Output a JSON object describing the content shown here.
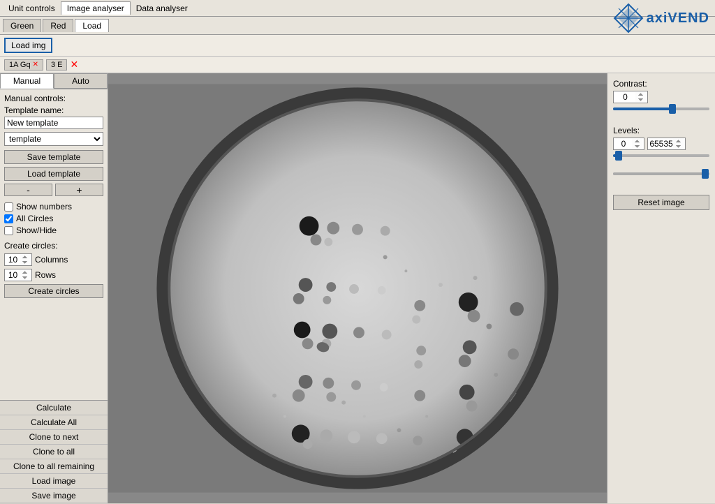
{
  "menubar": {
    "items": [
      "Unit controls",
      "Image analyser",
      "Data analyser"
    ],
    "active": "Image analyser"
  },
  "tabs": {
    "items": [
      "Green",
      "Red",
      "Load"
    ],
    "active": "Load"
  },
  "loadimg": {
    "button_label": "Load img"
  },
  "session": {
    "tab1": "1A Gq",
    "tab2": "3 E"
  },
  "panel": {
    "manual_tab": "Manual",
    "auto_tab": "Auto",
    "controls_label": "Manual controls:",
    "template_name_label": "Template name:",
    "template_name_value": "New template",
    "save_template": "Save template",
    "load_template": "Load template",
    "minus_label": "-",
    "plus_label": "+",
    "show_numbers_label": "Show numbers",
    "all_circles_label": "All Circles",
    "all_circles_checked": true,
    "show_hide_label": "Show/Hide",
    "create_circles_label": "Create circles:",
    "columns_value": "10",
    "columns_label": "Columns",
    "rows_value": "10",
    "rows_label": "Rows",
    "create_circles_btn": "Create circles"
  },
  "bottom_buttons": [
    "Calculate",
    "Calculate All",
    "Clone to next",
    "Clone to all",
    "Clone to all remaining",
    "Load image",
    "Save image"
  ],
  "right_panel": {
    "contrast_label": "Contrast:",
    "contrast_value": "0",
    "levels_label": "Levels:",
    "levels_min": "0",
    "levels_max": "65535",
    "reset_btn": "Reset image"
  },
  "logo": {
    "text": "axiVEND"
  }
}
